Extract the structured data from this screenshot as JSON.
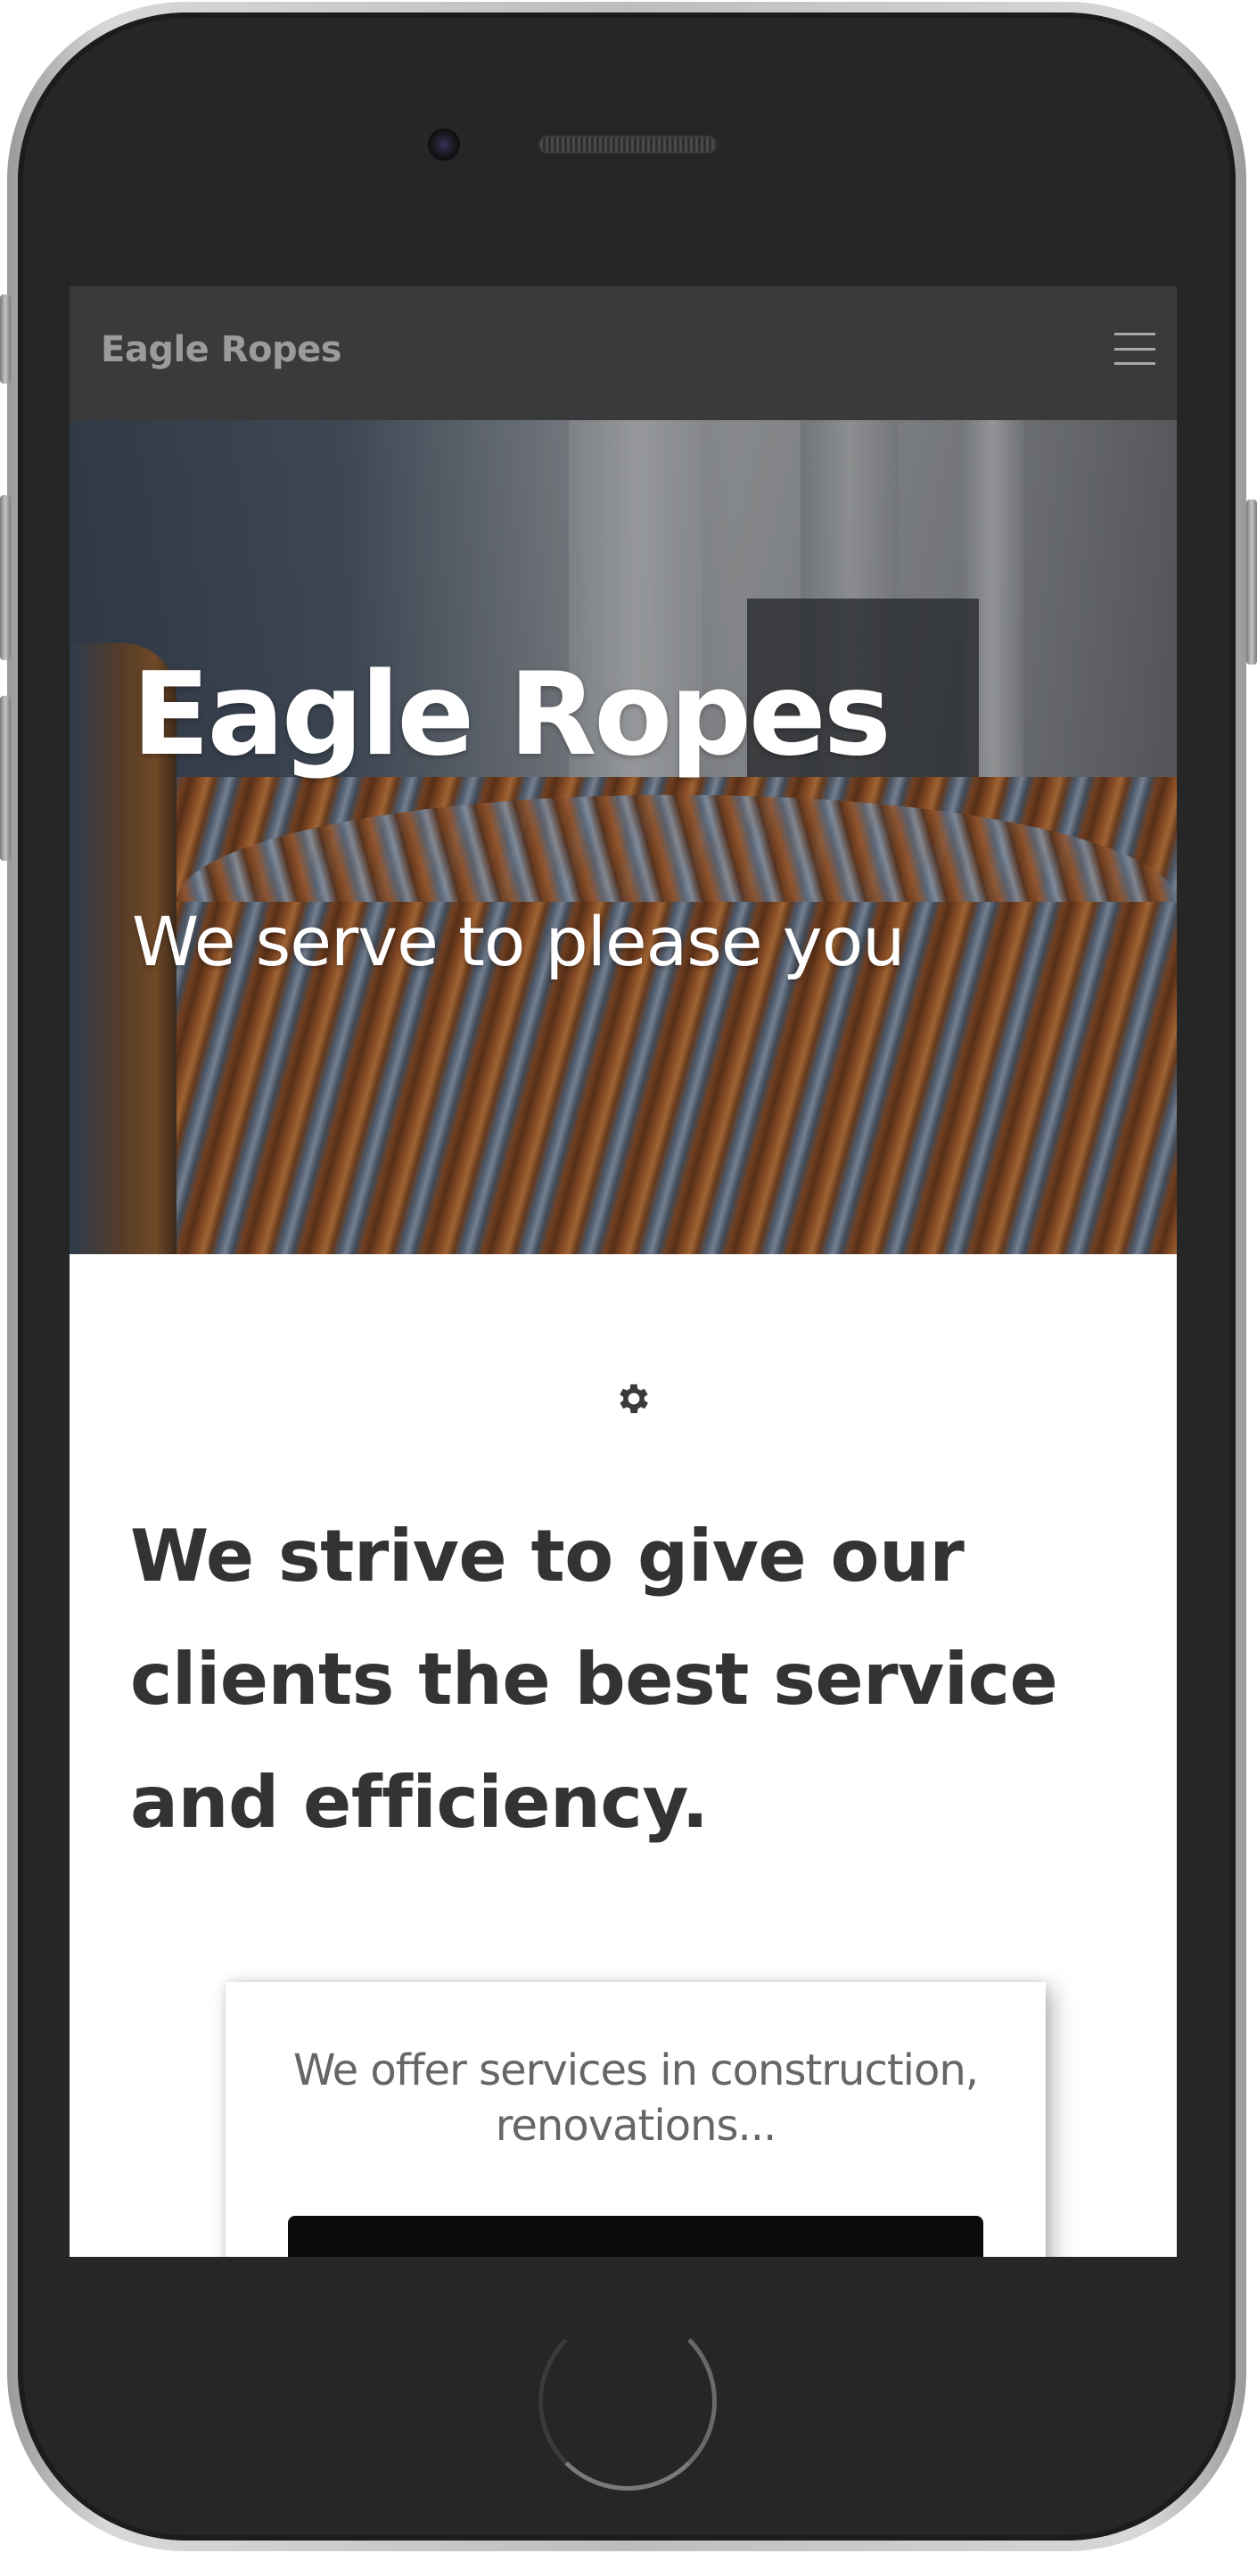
{
  "navbar": {
    "brand": "Eagle Ropes",
    "menu_icon": "hamburger-menu-icon"
  },
  "hero": {
    "title": "Eagle Ropes",
    "subtitle": "We serve to please you",
    "background_image": "rope-spool-photo"
  },
  "intro": {
    "icon": "gear-icon",
    "headline": "We strive to give our clients the best service and efficiency."
  },
  "card": {
    "text": "We offer services in construction, renovations...",
    "button_label": ""
  },
  "colors": {
    "navbar_bg": "#3a3a3a",
    "brand_text": "#9b9b9b",
    "headline_text": "#333333",
    "card_text": "#666666",
    "button_bg": "#0b0b0b",
    "phone_body": "#262626"
  }
}
